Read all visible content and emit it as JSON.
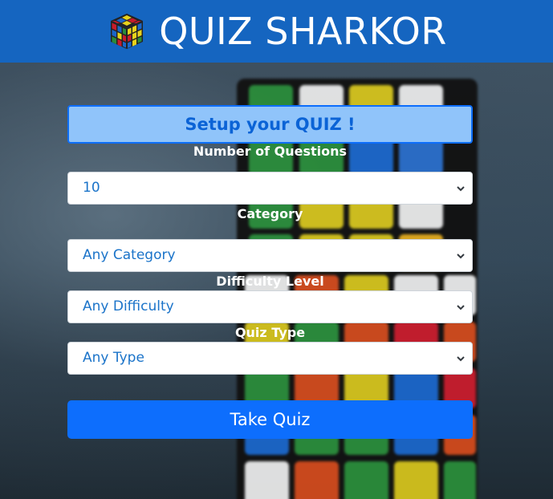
{
  "header": {
    "logo_icon": "rubiks-cube-icon",
    "title": "QUIZ SHARKOR",
    "color": "#1565c0"
  },
  "form": {
    "title": "Setup your QUIZ !",
    "fields": [
      {
        "label": "Number of Questions",
        "value": "10"
      },
      {
        "label": "Category",
        "value": "Any Category"
      },
      {
        "label": "Difficulty Level",
        "value": "Any Difficulty"
      },
      {
        "label": "Quiz Type",
        "value": "Any Type"
      }
    ],
    "submit_label": "Take Quiz",
    "accent": "#0d6efd"
  }
}
